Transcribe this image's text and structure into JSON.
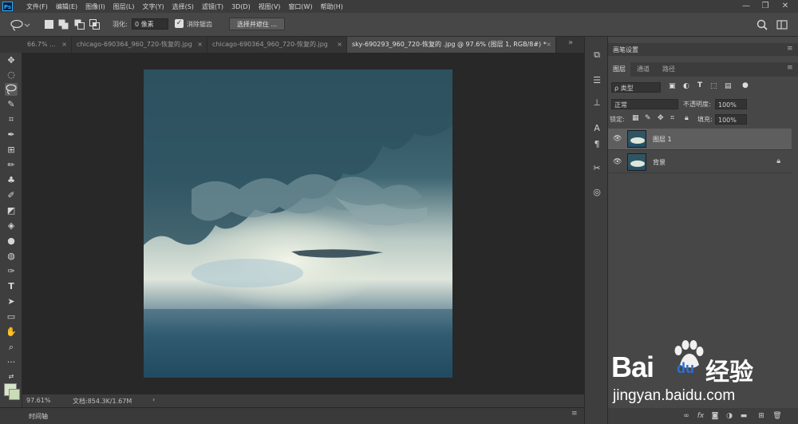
{
  "app": {
    "logo": "Ps"
  },
  "menu": [
    "文件(F)",
    "编辑(E)",
    "图像(I)",
    "图层(L)",
    "文字(Y)",
    "选择(S)",
    "滤镜(T)",
    "3D(D)",
    "视图(V)",
    "窗口(W)",
    "帮助(H)"
  ],
  "window_controls": [
    "minimize-icon",
    "restore-icon",
    "close-icon"
  ],
  "options": {
    "feather_label": "羽化:",
    "feather_value": "0 像素",
    "antialias_label": "消除锯齿",
    "antialias_checked": true,
    "select_mask_label": "选择并遮住 ..."
  },
  "tabs": [
    {
      "label": "66.7% ...",
      "close": "×",
      "active": false
    },
    {
      "label": "chicago-690364_960_720-恢复的.jpg",
      "close": "×",
      "active": false
    },
    {
      "label": "chicago-690364_960_720-恢复的.jpg",
      "close": "×",
      "active": false
    },
    {
      "label": "sky-690293_960_720-恢复的 .jpg @ 97.6% (图层 1, RGB/8#) *",
      "close": "×",
      "active": true
    }
  ],
  "status": {
    "zoom": "97.61%",
    "doc": "文档:854.3K/1.67M",
    "arrow": "›"
  },
  "timeline": {
    "label": "时间轴"
  },
  "panel": {
    "header": "画笔设置",
    "tabs": [
      "图层",
      "通道",
      "路径"
    ],
    "filter_kind": "ρ 类型",
    "blend_mode": "正常",
    "opacity_label": "不透明度:",
    "opacity_value": "100%",
    "lock_label": "锁定:",
    "fill_label": "填充:",
    "fill_value": "100%",
    "layers": [
      {
        "name": "图层 1",
        "selected": true,
        "locked": false
      },
      {
        "name": "背景",
        "selected": false,
        "locked": true
      }
    ],
    "bottom_icons": [
      "link-icon",
      "fx-icon",
      "mask-icon",
      "adjustment-icon",
      "group-icon",
      "new-layer-icon",
      "trash-icon"
    ]
  },
  "watermark": {
    "brand": "Bai",
    "brand_du": "du",
    "cn": "经验",
    "url": "jingyan.baidu.com"
  },
  "colors": {
    "accent": "#31a8ff",
    "panel": "#474747",
    "canvas_bg": "#282828"
  }
}
